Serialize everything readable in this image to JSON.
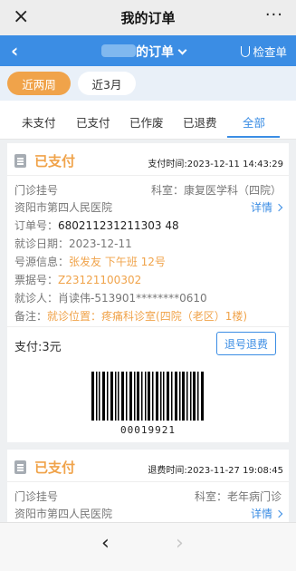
{
  "topbar": {
    "title": "我的订单",
    "close_icon": "×",
    "more_icon": "···"
  },
  "header": {
    "back_icon": "‹",
    "title": "的订单",
    "check_label": "检查单"
  },
  "periods": [
    {
      "label": "近两周",
      "active": true
    },
    {
      "label": "近3月",
      "active": false
    }
  ],
  "tabs": [
    {
      "label": "未支付"
    },
    {
      "label": "已支付"
    },
    {
      "label": "已作废"
    },
    {
      "label": "已退费"
    },
    {
      "label": "全部",
      "active": true
    }
  ],
  "order1": {
    "status": "已支付",
    "pay_time": "支付时间:2023-12-11 14:43:29",
    "type": "门诊挂号",
    "dept": "科室：康复医学科（四院）",
    "hospital": "资阳市第四人民医院",
    "detail": "详情",
    "order_no_label": "订单号：",
    "order_no": "680211231211303 48",
    "visit_date": "就诊日期：2023-12-11",
    "source_label": "号源信息：",
    "source_value": "张发友  下午班  12号",
    "ticket_label": "票据号：",
    "ticket_value": "Z23121100302",
    "patient_label": "就诊人：",
    "patient_value": "肖读伟-513901********0610",
    "note_label": "备注：",
    "note_value": "就诊位置：疼痛科诊室(四院（老区）1楼)",
    "payment": "支付:3元",
    "refund_button": "退号退费",
    "barcode_number": "00019921"
  },
  "order2": {
    "status": "已支付",
    "refund_time": "退费时间:2023-11-27 19:08:45",
    "type": "门诊挂号",
    "dept": "科室：老年病门诊",
    "hospital": "资阳市第四人民医院",
    "detail": "详情"
  },
  "bottomnav": {
    "back_icon": "‹",
    "forward_icon": "›"
  }
}
